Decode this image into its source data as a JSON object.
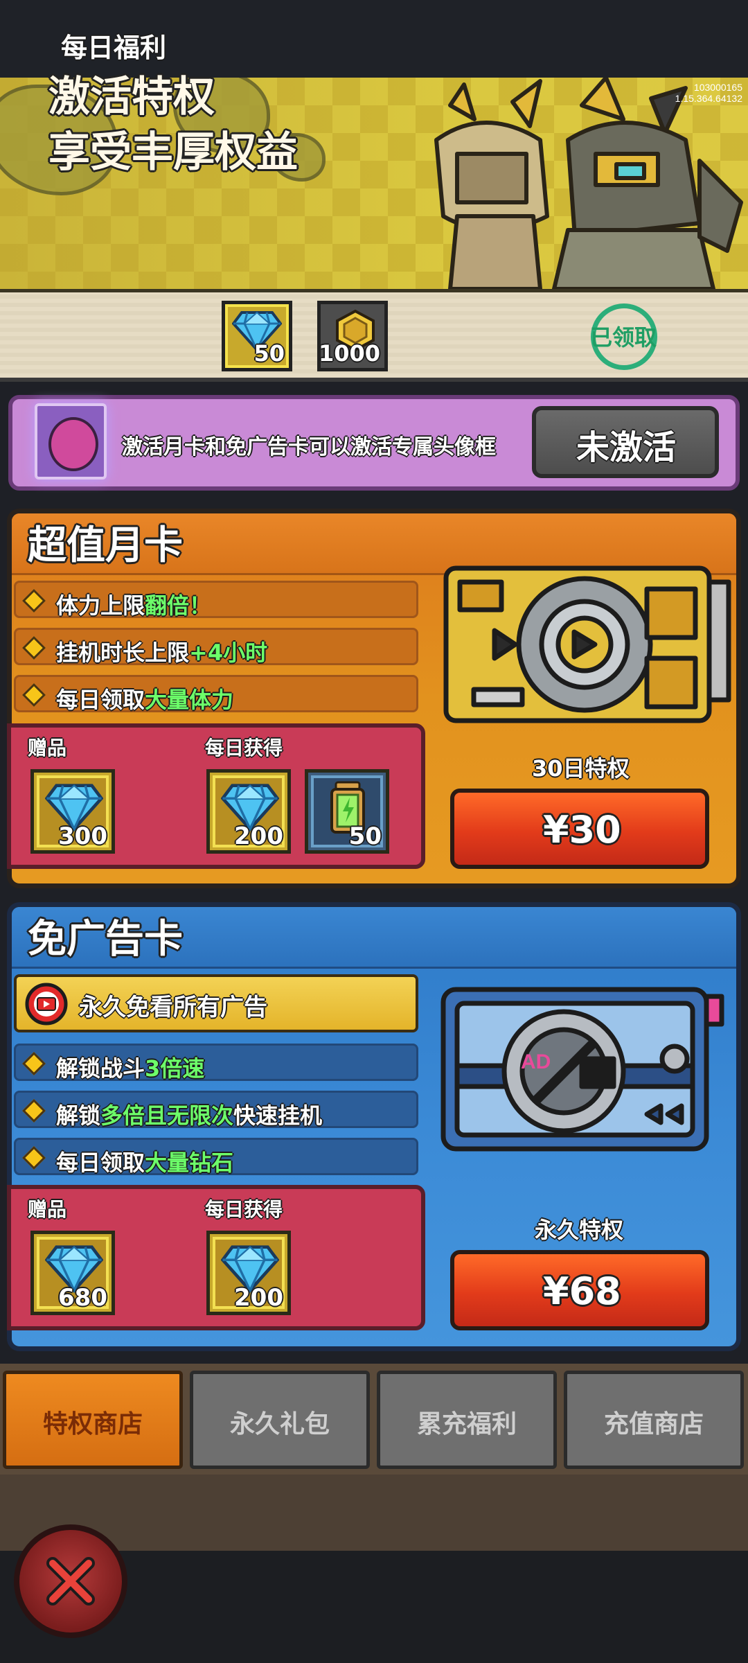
{
  "banner": {
    "title_line1": "激活特权",
    "title_line2": "享受丰厚权益",
    "version_line1": "103000165",
    "version_line2": "1.15.364.64132"
  },
  "daily": {
    "label": "每日福利",
    "rewards": [
      {
        "icon": "diamond-icon",
        "count": "50"
      },
      {
        "icon": "coin-icon",
        "count": "1000"
      }
    ],
    "claimed_label": "已领取"
  },
  "avatar_promo": {
    "text": "激活月卡和免广告卡可以激活专属头像框",
    "button_label": "未激活"
  },
  "monthly_card": {
    "title": "超值月卡",
    "features": [
      {
        "prefix": "体力上限",
        "highlight": "翻倍！",
        "suffix": ""
      },
      {
        "prefix": "挂机时长上限",
        "highlight": "+4小时",
        "suffix": ""
      },
      {
        "prefix": "每日领取",
        "highlight": "大量体力",
        "suffix": ""
      }
    ],
    "gift_label": "赠品",
    "daily_label": "每日获得",
    "gift_rewards": [
      {
        "icon": "diamond-icon",
        "count": "300"
      }
    ],
    "daily_rewards": [
      {
        "icon": "diamond-icon",
        "count": "200"
      },
      {
        "icon": "energy-battery-icon",
        "count": "50"
      }
    ],
    "duration": "30日特权",
    "price": "¥30"
  },
  "noad_card": {
    "title": "免广告卡",
    "main_feature": "永久免看所有广告",
    "features": [
      {
        "prefix": "解锁战斗",
        "highlight": "3倍速",
        "suffix": ""
      },
      {
        "prefix": "解锁",
        "highlight": "多倍且无限次",
        "suffix": "快速挂机"
      },
      {
        "prefix": "每日领取",
        "highlight": "大量钻石",
        "suffix": ""
      }
    ],
    "gift_label": "赠品",
    "daily_label": "每日获得",
    "gift_rewards": [
      {
        "icon": "diamond-icon",
        "count": "680"
      }
    ],
    "daily_rewards": [
      {
        "icon": "diamond-icon",
        "count": "200"
      }
    ],
    "ad_text": "AD",
    "duration": "永久特权",
    "price": "¥68"
  },
  "tabs": [
    {
      "label": "特权商店",
      "active": true
    },
    {
      "label": "永久礼包",
      "active": false
    },
    {
      "label": "累充福利",
      "active": false
    },
    {
      "label": "充值商店",
      "active": false
    }
  ],
  "colors": {
    "accent_orange": "#e2921e",
    "accent_blue": "#3b8ad6",
    "price_red": "#e23b1a",
    "highlight_green": "#6dff6a",
    "claimed_green": "#1f9e64"
  }
}
